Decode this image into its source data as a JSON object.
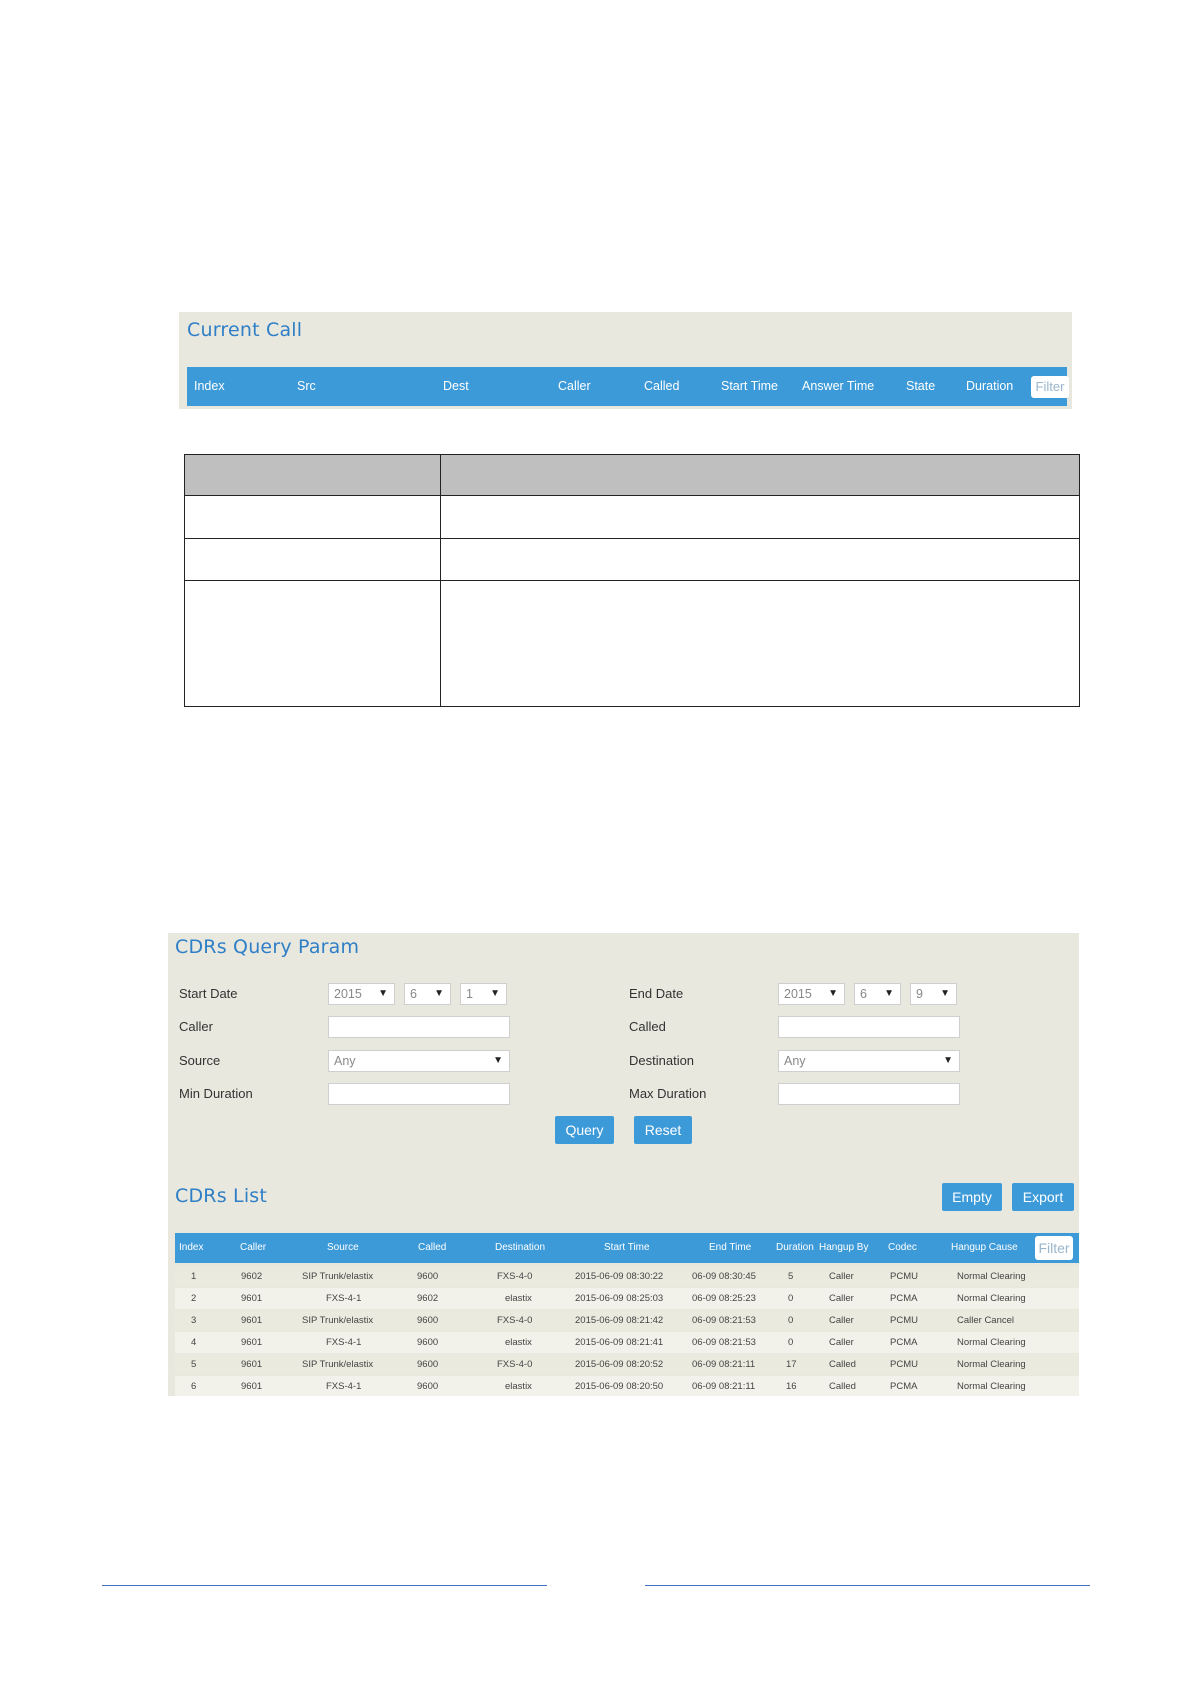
{
  "current_call": {
    "title": "Current Call",
    "columns": [
      "Index",
      "Src",
      "Dest",
      "Caller",
      "Called",
      "Start Time",
      "Answer Time",
      "State",
      "Duration"
    ],
    "filter_label": "Filter"
  },
  "query": {
    "title": "CDRs Query Param",
    "start_date_label": "Start Date",
    "start_year": "2015",
    "start_month": "6",
    "start_day": "1",
    "end_date_label": "End Date",
    "end_year": "2015",
    "end_month": "6",
    "end_day": "9",
    "caller_label": "Caller",
    "called_label": "Called",
    "source_label": "Source",
    "source_value": "Any",
    "destination_label": "Destination",
    "destination_value": "Any",
    "min_duration_label": "Min Duration",
    "max_duration_label": "Max Duration",
    "query_button": "Query",
    "reset_button": "Reset"
  },
  "cdr_list": {
    "title": "CDRs List",
    "empty_button": "Empty",
    "export_button": "Export",
    "filter_label": "Filter",
    "columns": [
      "Index",
      "Caller",
      "Source",
      "Called",
      "Destination",
      "Start Time",
      "End Time",
      "Duration",
      "Hangup By",
      "Codec",
      "Hangup Cause"
    ],
    "rows": [
      [
        "1",
        "9602",
        "SIP Trunk/elastix",
        "9600",
        "FXS-4-0",
        "2015-06-09 08:30:22",
        "06-09 08:30:45",
        "5",
        "Caller",
        "PCMU",
        "Normal Clearing"
      ],
      [
        "2",
        "9601",
        "FXS-4-1",
        "9602",
        "elastix",
        "2015-06-09 08:25:03",
        "06-09 08:25:23",
        "0",
        "Caller",
        "PCMA",
        "Normal Clearing"
      ],
      [
        "3",
        "9601",
        "SIP Trunk/elastix",
        "9600",
        "FXS-4-0",
        "2015-06-09 08:21:42",
        "06-09 08:21:53",
        "0",
        "Caller",
        "PCMU",
        "Caller Cancel"
      ],
      [
        "4",
        "9601",
        "FXS-4-1",
        "9600",
        "elastix",
        "2015-06-09 08:21:41",
        "06-09 08:21:53",
        "0",
        "Caller",
        "PCMA",
        "Normal Clearing"
      ],
      [
        "5",
        "9601",
        "SIP Trunk/elastix",
        "9600",
        "FXS-4-0",
        "2015-06-09 08:20:52",
        "06-09 08:21:11",
        "17",
        "Called",
        "PCMU",
        "Normal Clearing"
      ],
      [
        "6",
        "9601",
        "FXS-4-1",
        "9600",
        "elastix",
        "2015-06-09 08:20:50",
        "06-09 08:21:11",
        "16",
        "Called",
        "PCMA",
        "Normal Clearing"
      ]
    ]
  },
  "colors": {
    "accent": "#3d9ad8",
    "title": "#2f7fc6",
    "panel": "#e8e8df",
    "footer_line": "#4472c4"
  }
}
